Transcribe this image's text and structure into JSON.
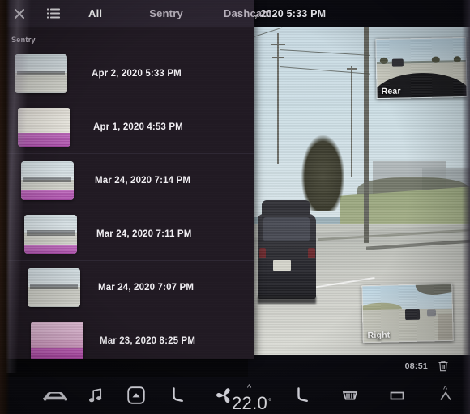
{
  "drawer": {
    "close_icon": "close-icon",
    "menu_icon": "list-menu-icon",
    "tabs": [
      {
        "label": "All",
        "active": true
      },
      {
        "label": "Sentry",
        "active": false
      },
      {
        "label": "Dashcam",
        "active": false
      }
    ],
    "section_label": "Sentry",
    "clips": [
      {
        "label": "Apr 2, 2020 5:33 PM",
        "thumb": "road"
      },
      {
        "label": "Apr 1, 2020 4:53 PM",
        "thumb": "wash"
      },
      {
        "label": "Mar 24, 2020 7:14 PM",
        "thumb": "road"
      },
      {
        "label": "Mar 24, 2020 7:11 PM",
        "thumb": "road"
      },
      {
        "label": "Mar 24, 2020 7:07 PM",
        "thumb": "road"
      },
      {
        "label": "Mar 23, 2020 8:25 PM",
        "thumb": "pink"
      }
    ]
  },
  "viewer": {
    "header_title": ", 2020 5:33 PM",
    "cameras": [
      {
        "name": "Rear"
      },
      {
        "name": "Right"
      }
    ],
    "playback": {
      "time": "08:51",
      "delete_icon": "trash-icon"
    }
  },
  "taskbar": {
    "items": [
      {
        "icon": "car-icon",
        "name": "car-controls"
      },
      {
        "icon": "music-note-icon",
        "name": "media"
      },
      {
        "icon": "volume-up-icon",
        "name": "volume"
      },
      {
        "icon": "seat-heater-icon",
        "name": "seat-heater-left"
      },
      {
        "icon": "fan-icon",
        "name": "fan"
      },
      {
        "icon": "seat-heater-icon",
        "name": "seat-heater-right"
      },
      {
        "icon": "rear-defrost-icon",
        "name": "rear-defrost"
      },
      {
        "icon": "front-defrost-icon",
        "name": "front-defrost"
      },
      {
        "icon": "seat-heater-icon",
        "name": "seat-heater-far-right"
      }
    ],
    "temperature": "22.0",
    "degree": "°"
  }
}
